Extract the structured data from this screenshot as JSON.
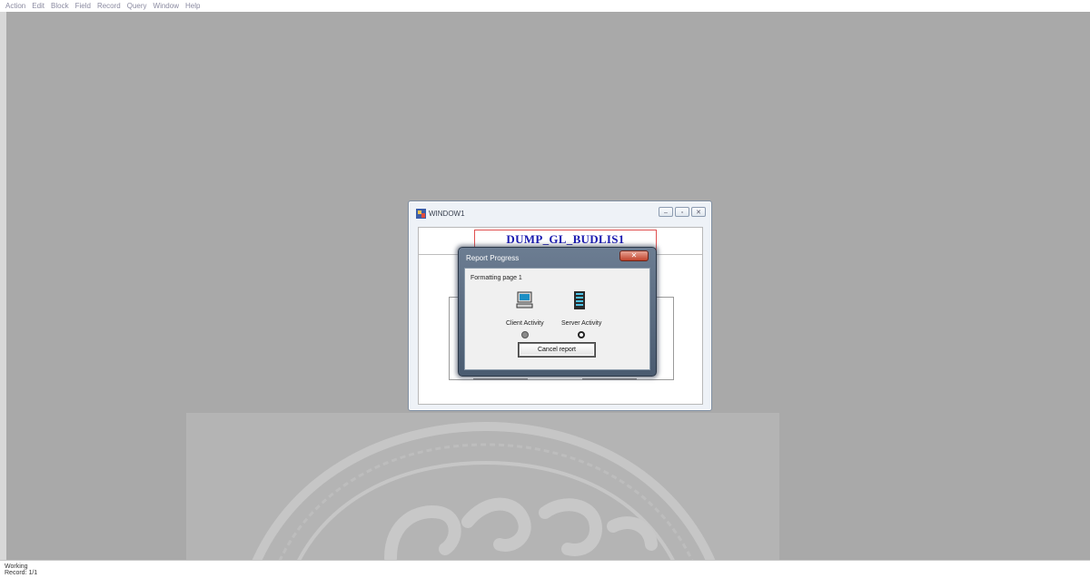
{
  "menubar": {
    "items": [
      "Action",
      "Edit",
      "Block",
      "Field",
      "Record",
      "Query",
      "Window",
      "Help"
    ]
  },
  "window": {
    "title": "WINDOW1",
    "controls": [
      "minimize",
      "maximize",
      "close"
    ],
    "form_title": "DUMP_GL_BUDLIS1"
  },
  "dialog": {
    "title": "Report Progress",
    "status": "Formatting page 1",
    "client_label": "Client Activity",
    "server_label": "Server Activity",
    "cancel_label": "Cancel report"
  },
  "statusbar": {
    "line1": "Working",
    "line2": "Record: 1/1"
  },
  "colors": {
    "desktop": "#a9a9a9",
    "form_title": "#1a1ab0",
    "close_button": "#c2442c"
  },
  "icons": [
    "app-icon",
    "client-computer-icon",
    "server-icon",
    "client-activity-indicator",
    "server-activity-indicator"
  ]
}
